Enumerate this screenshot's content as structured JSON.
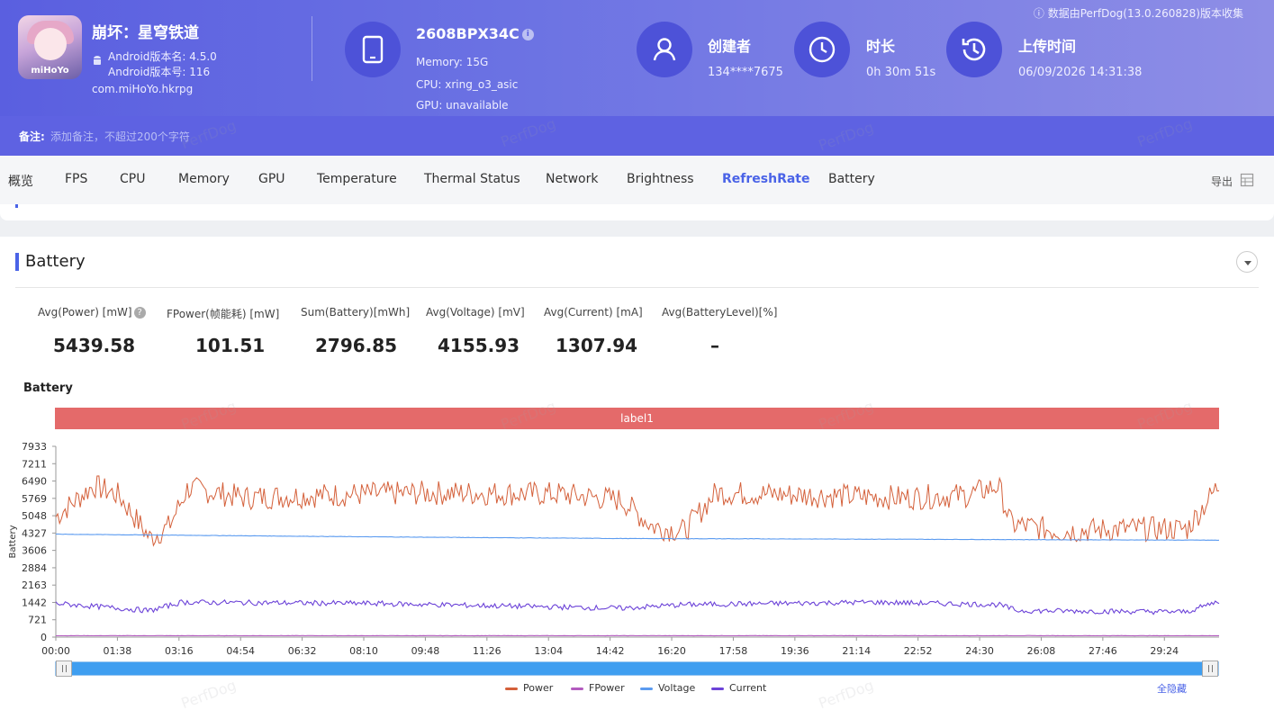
{
  "app": {
    "name": "崩坏：星穹铁道",
    "android_version_name": "Android版本名: 4.5.0",
    "android_version_code": "Android版本号: 116",
    "package": "com.miHoYo.hkrpg",
    "logo_text": "miHoYo"
  },
  "device": {
    "model": "2608BPX34C",
    "memory": "Memory: 15G",
    "cpu": "CPU: xring_o3_asic",
    "gpu": "GPU: unavailable"
  },
  "creator": {
    "label": "创建者",
    "value": "134****7675"
  },
  "duration": {
    "label": "时长",
    "value": "0h 30m 51s"
  },
  "upload": {
    "label": "上传时间",
    "value": "06/09/2026 14:31:38"
  },
  "source_note": "ⓘ 数据由PerfDog(13.0.260828)版本收集",
  "remark": {
    "label": "备注:",
    "placeholder": "添加备注，不超过200个字符"
  },
  "watermark": "PerfDog",
  "tabs": [
    {
      "label": "概览",
      "active": false
    },
    {
      "label": "FPS",
      "active": false
    },
    {
      "label": "CPU",
      "active": false
    },
    {
      "label": "Memory",
      "active": false
    },
    {
      "label": "GPU",
      "active": false
    },
    {
      "label": "Temperature",
      "active": false
    },
    {
      "label": "Thermal Status",
      "active": false
    },
    {
      "label": "Network",
      "active": false
    },
    {
      "label": "Brightness",
      "active": false
    },
    {
      "label": "RefreshRate",
      "active": true
    },
    {
      "label": "Battery",
      "active": false
    }
  ],
  "export_label": "导出",
  "section": {
    "title": "Battery",
    "stats": [
      {
        "label": "Avg(Power) [mW]",
        "value": "5439.58",
        "help": true
      },
      {
        "label": "FPower(帧能耗) [mW]",
        "value": "101.51"
      },
      {
        "label": "Sum(Battery)[mWh]",
        "value": "2796.85"
      },
      {
        "label": "Avg(Voltage) [mV]",
        "value": "4155.93"
      },
      {
        "label": "Avg(Current) [mA]",
        "value": "1307.94"
      },
      {
        "label": "Avg(BatteryLevel)[%]",
        "value": "–"
      }
    ]
  },
  "chart_data": {
    "type": "line",
    "title": "Battery",
    "ylabel": "Battery",
    "label_band": "label1",
    "y_ticks": [
      0,
      721,
      1442,
      2163,
      2884,
      3606,
      4327,
      5048,
      5769,
      6490,
      7211,
      7933
    ],
    "ylim": [
      0,
      7933
    ],
    "x_ticks": [
      "00:00",
      "01:38",
      "03:16",
      "04:54",
      "06:32",
      "08:10",
      "09:48",
      "11:26",
      "13:04",
      "14:42",
      "16:20",
      "17:58",
      "19:36",
      "21:14",
      "22:52",
      "24:30",
      "26:08",
      "27:46",
      "29:24"
    ],
    "x_range_seconds": [
      0,
      1851
    ],
    "series": [
      {
        "name": "Power",
        "color": "#d4603a",
        "keypoints": [
          [
            0,
            5000
          ],
          [
            60,
            6300
          ],
          [
            100,
            5900
          ],
          [
            150,
            4100
          ],
          [
            180,
            4600
          ],
          [
            210,
            6200
          ],
          [
            300,
            5800
          ],
          [
            420,
            5900
          ],
          [
            600,
            6000
          ],
          [
            800,
            5950
          ],
          [
            900,
            5700
          ],
          [
            950,
            4600
          ],
          [
            1000,
            4400
          ],
          [
            1050,
            6000
          ],
          [
            1200,
            5900
          ],
          [
            1350,
            5800
          ],
          [
            1450,
            5900
          ],
          [
            1500,
            6300
          ],
          [
            1520,
            4700
          ],
          [
            1600,
            4400
          ],
          [
            1700,
            4500
          ],
          [
            1800,
            4500
          ],
          [
            1850,
            6300
          ]
        ]
      },
      {
        "name": "FPower",
        "color": "#b35bbf",
        "keypoints": [
          [
            0,
            60
          ],
          [
            1851,
            60
          ]
        ]
      },
      {
        "name": "Voltage",
        "color": "#5b9bf0",
        "keypoints": [
          [
            0,
            4280
          ],
          [
            500,
            4170
          ],
          [
            900,
            4100
          ],
          [
            1200,
            4080
          ],
          [
            1851,
            4030
          ]
        ]
      },
      {
        "name": "Current",
        "color": "#6c43d8",
        "keypoints": [
          [
            0,
            1400
          ],
          [
            150,
            1100
          ],
          [
            200,
            1450
          ],
          [
            500,
            1400
          ],
          [
            900,
            1200
          ],
          [
            1000,
            1350
          ],
          [
            1300,
            1450
          ],
          [
            1500,
            1350
          ],
          [
            1530,
            1100
          ],
          [
            1800,
            1050
          ],
          [
            1851,
            1500
          ]
        ]
      }
    ]
  },
  "hide_all_label": "全隐藏"
}
